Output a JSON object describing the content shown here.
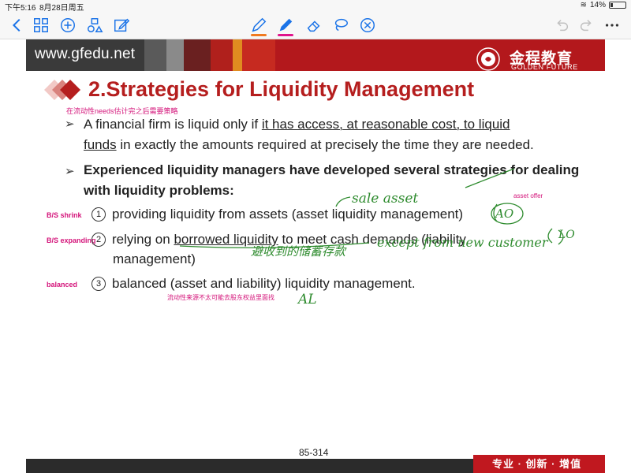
{
  "status_bar": {
    "time": "下午5:16",
    "date": "8月28日周五",
    "battery": "14%"
  },
  "slide": {
    "website": "www.gfedu.net",
    "logo_cn": "金程教育",
    "logo_en": "GOLDEN FUTURE",
    "title": "2.Strategies for Liquidity Management",
    "note_cn_title": "在流动性needs估计完之后需要策略",
    "bullet1": {
      "lead": "A financial firm is liquid only if ",
      "underline1": "it has access, at reasonable cost, to liquid",
      "underline2": "funds",
      "tail": " in exactly the amounts required at precisely the time they are needed."
    },
    "bullet2": "Experienced liquidity managers have developed several strategies for dealing with liquidity problems:",
    "items": [
      {
        "num": "1",
        "side": "B/S shrink",
        "text": "providing liquidity from assets (asset liquidity management)"
      },
      {
        "num": "2",
        "side": "B/S expanding",
        "prefix": "relying on ",
        "underline": "borrowed liquidity",
        "suffix": " to meet cash demands (liability",
        "line2": "management)"
      },
      {
        "num": "3",
        "side": "balanced",
        "text": "balanced (asset and liability) liquidity management."
      }
    ],
    "note_asset_offer": "asset offer",
    "note_cn_bottom": "流动性来源不太可能去股东权益里面找",
    "handwriting": {
      "sale_asset": "sale asset",
      "ao": "AO",
      "cn_scrawl": "避收到的储蓄存款",
      "except": "except from new customer",
      "lo": "LO",
      "al": "AL"
    },
    "page_number": "85-314",
    "motto": "专业 · 创新 · 增值"
  },
  "colors": {
    "title_red": "#b51e1e",
    "banner_red": "#8b1d1d",
    "note_pink": "#d4147a",
    "ink_green": "#2e8b2e",
    "toolbar_blue": "#1a73e8"
  }
}
